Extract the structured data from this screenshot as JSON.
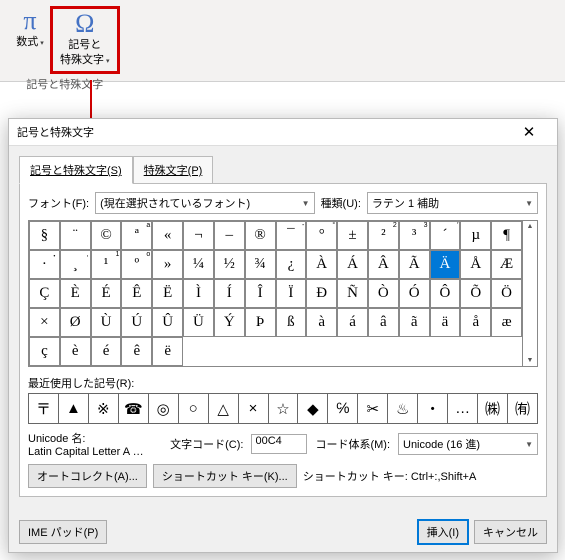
{
  "ribbon": {
    "equation": {
      "icon": "π",
      "label": "数式"
    },
    "symbol": {
      "icon": "Ω",
      "label1": "記号と",
      "label2": "特殊文字"
    },
    "group_caption": "記号と特殊文字"
  },
  "dialog": {
    "title": "記号と特殊文字"
  },
  "tabs": {
    "symbolsLabel": "記号と特殊文字(S)",
    "specialLabel": "特殊文字(P)"
  },
  "fontRow": {
    "label": "フォント(F):",
    "value": "(現在選択されているフォント)",
    "subsetLabel": "種類(U):",
    "subsetValue": "ラテン 1 補助"
  },
  "grid": [
    {
      "c": "§"
    },
    {
      "c": "¨"
    },
    {
      "c": "©"
    },
    {
      "c": "ª",
      "b": "a"
    },
    {
      "c": "«"
    },
    {
      "c": "¬"
    },
    {
      "c": "–"
    },
    {
      "c": "®"
    },
    {
      "c": "¯",
      "b": "-"
    },
    {
      "c": "°",
      "b": "°"
    },
    {
      "c": "±"
    },
    {
      "c": "²",
      "b": "2"
    },
    {
      "c": "³",
      "b": "3"
    },
    {
      "c": "´",
      "b": "′"
    },
    {
      "c": "µ"
    },
    {
      "c": "¶"
    },
    {
      "c": "·",
      "b": "・"
    },
    {
      "c": "¸",
      "b": ","
    },
    {
      "c": "¹",
      "b": "1"
    },
    {
      "c": "º",
      "b": "o"
    },
    {
      "c": "»"
    },
    {
      "c": "¼"
    },
    {
      "c": "½"
    },
    {
      "c": "¾"
    },
    {
      "c": "¿"
    },
    {
      "c": "À"
    },
    {
      "c": "Á"
    },
    {
      "c": "Â"
    },
    {
      "c": "Ã"
    },
    {
      "c": "Ä",
      "sel": true
    },
    {
      "c": "Å"
    },
    {
      "c": "Æ"
    },
    {
      "c": "Ç"
    },
    {
      "c": "È"
    },
    {
      "c": "É"
    },
    {
      "c": "Ê"
    },
    {
      "c": "Ë"
    },
    {
      "c": "Ì"
    },
    {
      "c": "Í"
    },
    {
      "c": "Î"
    },
    {
      "c": "Ï"
    },
    {
      "c": "Đ"
    },
    {
      "c": "Ñ"
    },
    {
      "c": "Ò"
    },
    {
      "c": "Ó"
    },
    {
      "c": "Ô"
    },
    {
      "c": "Õ"
    },
    {
      "c": "Ö"
    },
    {
      "c": "×"
    },
    {
      "c": "Ø"
    },
    {
      "c": "Ù"
    },
    {
      "c": "Ú"
    },
    {
      "c": "Û"
    },
    {
      "c": "Ü"
    },
    {
      "c": "Ý"
    },
    {
      "c": "Þ"
    },
    {
      "c": "ß"
    },
    {
      "c": "à"
    },
    {
      "c": "á"
    },
    {
      "c": "â"
    },
    {
      "c": "ã"
    },
    {
      "c": "ä"
    },
    {
      "c": "å"
    },
    {
      "c": "æ"
    },
    {
      "c": "ç"
    },
    {
      "c": "è"
    },
    {
      "c": "é"
    },
    {
      "c": "ê"
    },
    {
      "c": "ë"
    }
  ],
  "recent": {
    "label": "最近使用した記号(R):",
    "items": [
      "〒",
      "▲",
      "※",
      "☎",
      "◎",
      "○",
      "△",
      "×",
      "☆",
      "◆",
      "℅",
      "✂",
      "♨",
      "・",
      "…",
      "㈱",
      "㈲"
    ]
  },
  "info": {
    "unicodeLabel": "Unicode 名:",
    "charName": "Latin Capital Letter A …",
    "codeLabel": "文字コード(C):",
    "codeValue": "00C4",
    "systemLabel": "コード体系(M):",
    "systemValue": "Unicode (16 進)"
  },
  "buttons": {
    "autoCorrect": "オートコレクト(A)...",
    "shortcutKey": "ショートカット キー(K)...",
    "shortcutInfo": "ショートカット キー: Ctrl+:,Shift+A",
    "imePad": "IME パッド(P)",
    "insert": "挿入(I)",
    "cancel": "キャンセル"
  }
}
